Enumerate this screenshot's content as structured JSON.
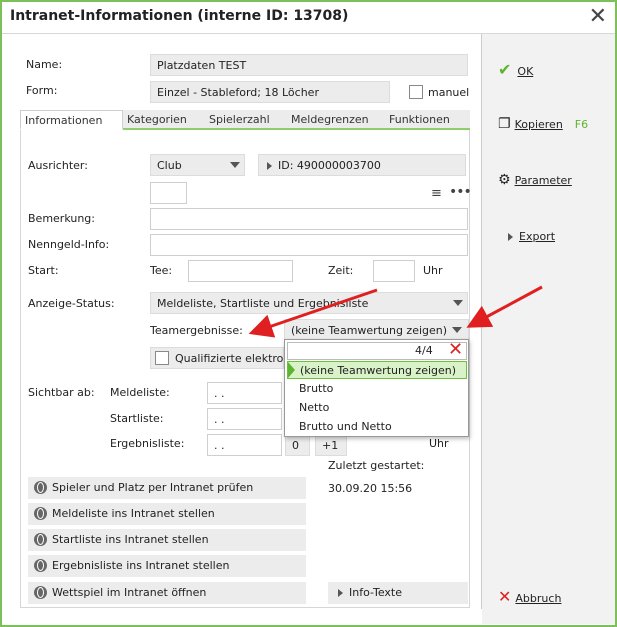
{
  "window": {
    "title": "Intranet-Informationen (interne ID: 13708)"
  },
  "header": {
    "name_label": "Name:",
    "name_value": "Platzdaten TEST",
    "form_label": "Form:",
    "form_value": "Einzel - Stableford; 18 Löcher",
    "manuel_label": "manuel"
  },
  "tabs": [
    "Informationen",
    "Kategorien",
    "Spielerzahl",
    "Meldegrenzen",
    "Funktionen"
  ],
  "main": {
    "ausrichter_label": "Ausrichter:",
    "ausrichter_value": "Club",
    "id_value": "ID: 490000003700",
    "bemerkung_label": "Bemerkung:",
    "nenngeld_label": "Nenngeld-Info:",
    "start_label": "Start:",
    "tee_label": "Tee:",
    "zeit_label": "Zeit:",
    "uhr_label": "Uhr",
    "anzeige_label": "Anzeige-Status:",
    "anzeige_value": "Meldeliste, Startliste und Ergebnisliste",
    "team_label": "Teamergebnisse:",
    "team_value": "(keine Teamwertung zeigen)",
    "qualifiziert_label": "Qualifizierte elektron",
    "sichtbar_label": "Sichtbar ab:",
    "meldeliste_label": "Meldeliste:",
    "startliste_label": "Startliste:",
    "ergebnisliste_label": "Ergebnisliste:",
    "date_placeholder": ".  .",
    "ergebnis_zero": "0",
    "ergebnis_plus": "+1",
    "ergebnis_uhr": "Uhr",
    "zuletzt_label": "Zuletzt gestartet:",
    "zuletzt_value": "30.09.20 15:56"
  },
  "actions": [
    "Spieler und Platz per Intranet prüfen",
    "Meldeliste ins Intranet stellen",
    "Startliste ins Intranet stellen",
    "Ergebnisliste ins Intranet stellen",
    "Wettspiel im Intranet öffnen"
  ],
  "info_texte": "Info-Texte",
  "dropdown": {
    "count": "4/4",
    "options": [
      "(keine Teamwertung zeigen)",
      "Brutto",
      "Netto",
      "Brutto und Netto"
    ],
    "selected_index": 0
  },
  "sidebar": {
    "ok": "OK",
    "kopieren": "Kopieren",
    "kopieren_key": "F6",
    "parameter": "Parameter",
    "export": "Export",
    "abbruch": "Abbruch"
  },
  "colors": {
    "accent_green": "#5cb531",
    "arrow_red": "#e02020",
    "border_green": "#7cc05a"
  }
}
